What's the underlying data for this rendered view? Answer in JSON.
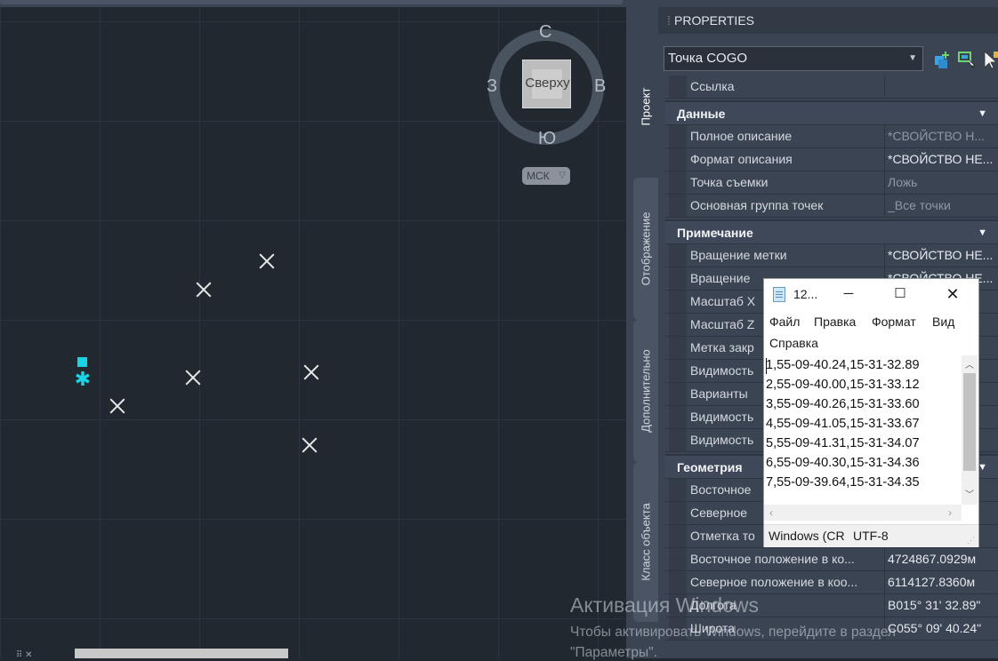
{
  "viewcube": {
    "north": "С",
    "south": "Ю",
    "west": "З",
    "east": "В",
    "face": "Сверху",
    "ucs": "МСК"
  },
  "palette": {
    "title": "PROPERTIES",
    "object_type": "Точка COGO",
    "side_tabs": [
      "Проект",
      "Отображение",
      "Дополнительно",
      "Класс объекта"
    ],
    "top_row": {
      "name": "Ссылка",
      "value": ""
    },
    "categories": [
      {
        "title": "Данные",
        "rows": [
          {
            "name": "Полное описание",
            "value": "*СВОЙСТВО Н..."
          },
          {
            "name": "Формат описания",
            "value": "*СВОЙСТВО НЕ..."
          },
          {
            "name": "Точка съемки",
            "value": "Ложь"
          },
          {
            "name": "Основная группа точек",
            "value": "_Все точки"
          }
        ]
      },
      {
        "title": "Примечание",
        "rows": [
          {
            "name": "Вращение метки",
            "value": "*СВОЙСТВО НЕ..."
          },
          {
            "name": "Вращение",
            "value": "*СВОЙСТВО НЕ..."
          },
          {
            "name": "Масштаб X",
            "value": ""
          },
          {
            "name": "Масштаб Z",
            "value": ""
          },
          {
            "name": "Метка закр",
            "value": ""
          },
          {
            "name": "Видимость",
            "value": ""
          },
          {
            "name": "Варианты",
            "value": ""
          },
          {
            "name": "Видимость",
            "value": ""
          },
          {
            "name": "Видимость",
            "value": ""
          }
        ]
      },
      {
        "title": "Геометрия",
        "rows": [
          {
            "name": "Восточное",
            "value": ""
          },
          {
            "name": "Северное",
            "value": ""
          },
          {
            "name": "Отметка то",
            "value": ""
          },
          {
            "name": "Восточное положение в ко...",
            "value": "4724867.0929м"
          },
          {
            "name": "Северное положение в коо...",
            "value": "6114127.8360м"
          },
          {
            "name": "Долгота",
            "value": "В015° 31' 32.89\""
          },
          {
            "name": "Широта",
            "value": "С055° 09' 40.24\""
          }
        ]
      }
    ]
  },
  "notepad": {
    "title": "12...",
    "menu": [
      "Файл",
      "Правка",
      "Формат",
      "Вид",
      "Справка"
    ],
    "lines": [
      "1,55-09-40.24,15-31-32.89",
      "2,55-09-40.00,15-31-33.12",
      "3,55-09-40.26,15-31-33.60",
      "4,55-09-41.05,15-31-33.67",
      "5,55-09-41.31,15-31-34.07",
      "6,55-09-40.30,15-31-34.36",
      "7,55-09-39.64,15-31-34.35"
    ],
    "status_eol": "Windows (CR",
    "status_encoding": "UTF-8"
  },
  "watermark": {
    "heading": "Активация Windows",
    "line1": "Чтобы активировать Windows, перейдите в раздел",
    "line2": "\"Параметры\"."
  },
  "colors": {
    "canvas": "#212830",
    "grid": "#2b3440",
    "selection": "#19d3e6",
    "palette_bg": "#3b4453"
  }
}
